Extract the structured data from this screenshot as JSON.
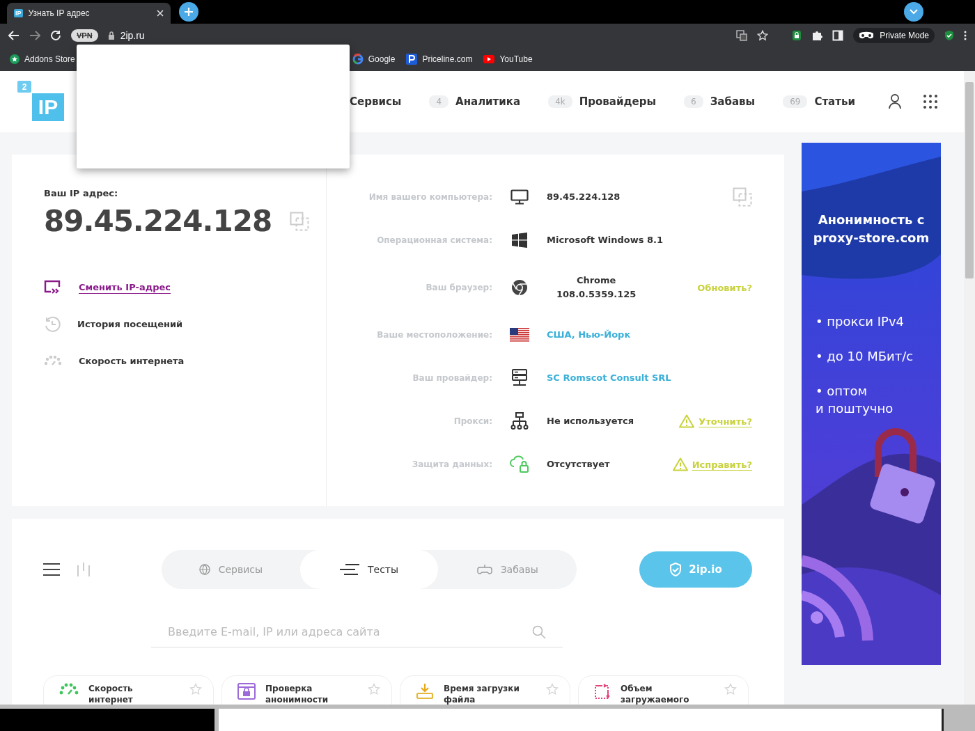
{
  "browser": {
    "tab_icon": "IP",
    "tab_title": "Узнать IP адрес",
    "vpn_badge": "VPN",
    "url": "2ip.ru",
    "private_mode": "Private Mode",
    "bookmarks": [
      {
        "label": "Addons Store"
      },
      {
        "label": "Google"
      },
      {
        "label": "Priceline.com"
      },
      {
        "label": "YouTube"
      }
    ]
  },
  "header": {
    "logo_badge": "2",
    "logo_mark": "IP",
    "nav": [
      {
        "label": "Сервисы"
      },
      {
        "count": "4",
        "label": "Аналитика"
      },
      {
        "count": "4k",
        "label": "Провайдеры"
      },
      {
        "count": "6",
        "label": "Забавы"
      },
      {
        "count": "69",
        "label": "Статьи"
      }
    ]
  },
  "ip_card": {
    "label": "Ваш IP адрес:",
    "ip": "89.45.224.128",
    "links": [
      {
        "label": "Сменить IP-адрес",
        "kind": "link"
      },
      {
        "label": "История посещений",
        "kind": "plain"
      },
      {
        "label": "Скорость интернета",
        "kind": "plain"
      }
    ]
  },
  "info_rows": [
    {
      "label": "Имя вашего компьютера:",
      "value": "89.45.224.128",
      "kind": "text",
      "action": {
        "kind": "copy"
      }
    },
    {
      "label": "Операционная система:",
      "value": "Microsoft Windows 8.1",
      "kind": "text"
    },
    {
      "label": "Ваш браузер:",
      "value": "Chrome\n108.0.5359.125",
      "kind": "stacked",
      "action": {
        "kind": "text",
        "text": "Обновить?",
        "warning": false
      }
    },
    {
      "label": "Ваше местоположение:",
      "value": "США, Нью-Йорк",
      "kind": "link"
    },
    {
      "label": "Ваш провайдер:",
      "value": "SC Romscot Consult SRL",
      "kind": "link"
    },
    {
      "label": "Прокси:",
      "value": "Не используется",
      "kind": "text",
      "action": {
        "kind": "text",
        "text": "Уточнить?",
        "warning": true
      }
    },
    {
      "label": "Защита данных:",
      "value": "Отсутствует",
      "kind": "text",
      "action": {
        "kind": "text",
        "text": "Исправить?",
        "warning": true
      }
    }
  ],
  "tools": {
    "tabs": [
      {
        "label": "Сервисы",
        "selected": false
      },
      {
        "label": "Тесты",
        "selected": true
      },
      {
        "label": "Забавы",
        "selected": false
      }
    ],
    "button": "2ip.io",
    "search": {
      "placeholder": "Введите E-mail, IP или адреса сайта"
    },
    "tiles": [
      {
        "title": "Скорость интернет"
      },
      {
        "title": "Проверка анонимности"
      },
      {
        "title": "Время загрузки файла"
      },
      {
        "title": "Объем загружаемого"
      }
    ]
  },
  "ad": {
    "headline": "Анонимность с proxy-store.com",
    "bullets": [
      "• прокси IPv4",
      "• до 10 МБит/с",
      "• оптом\nи поштучно"
    ]
  }
}
